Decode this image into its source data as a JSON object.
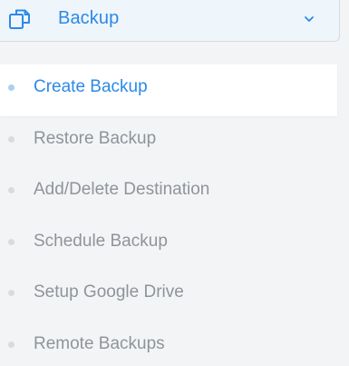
{
  "header": {
    "title": "Backup",
    "icon": "copy-pages-icon",
    "chevron": "chevron-down-icon",
    "accent_color": "#2b8ae6"
  },
  "menu": {
    "items": [
      {
        "label": "Create Backup",
        "active": true
      },
      {
        "label": "Restore Backup",
        "active": false
      },
      {
        "label": "Add/Delete Destination",
        "active": false
      },
      {
        "label": "Schedule Backup",
        "active": false
      },
      {
        "label": "Setup Google Drive",
        "active": false
      },
      {
        "label": "Remote Backups",
        "active": false
      }
    ]
  }
}
